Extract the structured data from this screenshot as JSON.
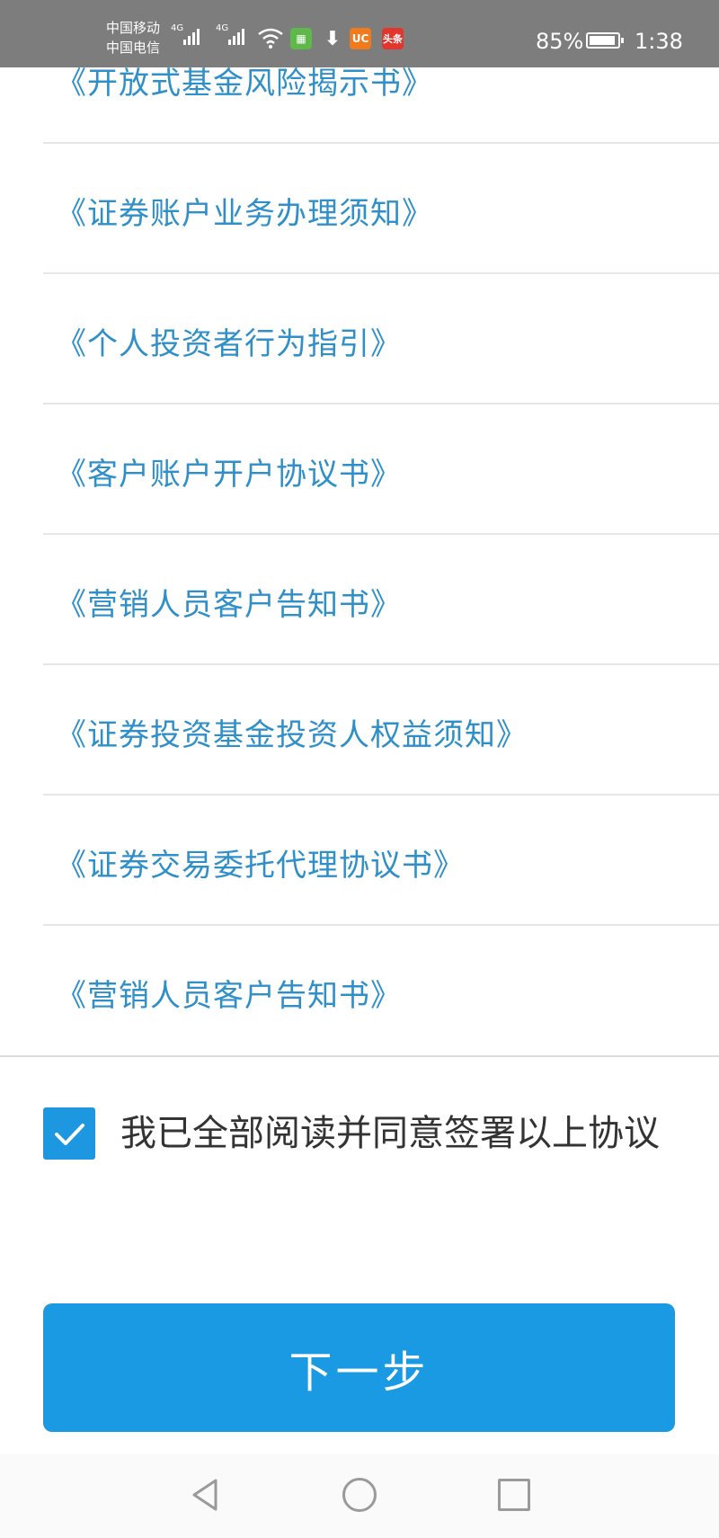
{
  "status_bar": {
    "carrier_1": "中国移动",
    "carrier_2": "中国电信",
    "net_1": "4G",
    "net_2": "4G",
    "app_icons": [
      "green-app-icon",
      "download-icon",
      "uc-browser-icon",
      "toutiao-icon"
    ],
    "app_icon_labels": {
      "uc": "UC",
      "toutiao": "头条"
    },
    "battery_percent": "85%",
    "battery_level": 0.85,
    "time": "1:38",
    "background_color": "#7d7d7d"
  },
  "agreements": [
    {
      "label": "《开放式基金风险揭示书》"
    },
    {
      "label": "《证券账户业务办理须知》"
    },
    {
      "label": "《个人投资者行为指引》"
    },
    {
      "label": "《客户账户开户协议书》"
    },
    {
      "label": "《营销人员客户告知书》"
    },
    {
      "label": "《证券投资基金投资人权益须知》"
    },
    {
      "label": "《证券交易委托代理协议书》"
    },
    {
      "label": "《营销人员客户告知书》"
    }
  ],
  "consent": {
    "checked": true,
    "text": "我已全部阅读并同意签署以上协议"
  },
  "next_button": {
    "label": "下一步"
  },
  "colors": {
    "link": "#2f8fc8",
    "accent": "#1a9ae3",
    "checkbox": "#1c97e0"
  },
  "nav_bar": {
    "icons": [
      "back-icon",
      "home-icon",
      "recents-icon"
    ]
  }
}
